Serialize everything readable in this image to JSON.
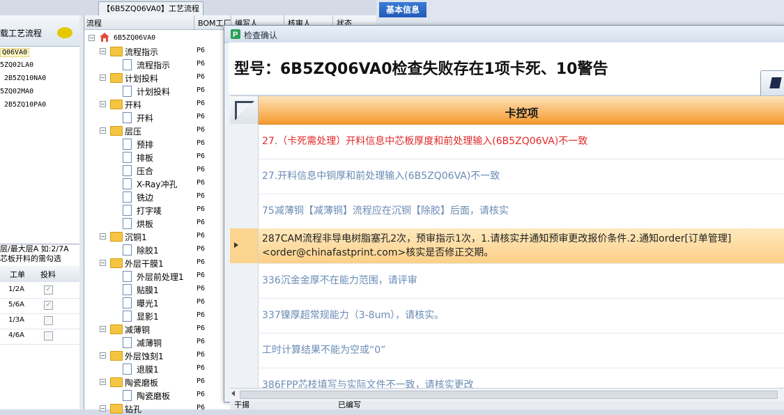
{
  "left_panel": {
    "title": "载工艺流程",
    "items": [
      "Q06VA0",
      "5ZQ02LA0",
      "2B5ZQ10NA0",
      "5ZQ02MA0",
      "2B5ZQ10PA0"
    ],
    "hint_line1": "层/最大层A 如:2/7A",
    "hint_line2": "芯板开料的需勾选",
    "table_headers": {
      "order": "工单",
      "feed": "投料"
    },
    "table_rows": [
      {
        "order": "1/2A",
        "checked": true
      },
      {
        "order": "5/6A",
        "checked": true
      },
      {
        "order": "1/3A",
        "checked": false
      },
      {
        "order": "4/6A",
        "checked": false
      }
    ]
  },
  "middle": {
    "title": "【6B5ZQ06VA0】工艺流程",
    "headers": {
      "flow": "流程",
      "bom": "BOM工厂",
      "writer": "编写人",
      "reviewer": "核审人",
      "status": "状态"
    },
    "root": "6B5ZQ06VA0",
    "tree": [
      {
        "label": "流程指示",
        "level": 1,
        "bom": "P6"
      },
      {
        "label": "流程指示",
        "level": 2,
        "bom": "P6"
      },
      {
        "label": "计划投料",
        "level": 1,
        "bom": "P6"
      },
      {
        "label": "计划投料",
        "level": 2,
        "bom": "P6"
      },
      {
        "label": "开料",
        "level": 1,
        "bom": "P6"
      },
      {
        "label": "开料",
        "level": 2,
        "bom": "P6"
      },
      {
        "label": "层压",
        "level": 1,
        "bom": "P6"
      },
      {
        "label": "预排",
        "level": 2,
        "bom": "P6"
      },
      {
        "label": "排板",
        "level": 2,
        "bom": "P6"
      },
      {
        "label": "压合",
        "level": 2,
        "bom": "P6"
      },
      {
        "label": "X-Ray冲孔",
        "level": 2,
        "bom": "P6"
      },
      {
        "label": "铣边",
        "level": 2,
        "bom": "P6"
      },
      {
        "label": "打字唛",
        "level": 2,
        "bom": "P6"
      },
      {
        "label": "烘板",
        "level": 2,
        "bom": "P6"
      },
      {
        "label": "沉铜1",
        "level": 1,
        "bom": "P6"
      },
      {
        "label": "除胶1",
        "level": 2,
        "bom": "P6"
      },
      {
        "label": "外层干膜1",
        "level": 1,
        "bom": "P6"
      },
      {
        "label": "外层前处理1",
        "level": 2,
        "bom": "P6"
      },
      {
        "label": "贴膜1",
        "level": 2,
        "bom": "P6"
      },
      {
        "label": "曝光1",
        "level": 2,
        "bom": "P6"
      },
      {
        "label": "显影1",
        "level": 2,
        "bom": "P6"
      },
      {
        "label": "减薄铜",
        "level": 1,
        "bom": "P6"
      },
      {
        "label": "减薄铜",
        "level": 2,
        "bom": "P6"
      },
      {
        "label": "外层蚀刻1",
        "level": 1,
        "bom": "P6"
      },
      {
        "label": "退膜1",
        "level": 2,
        "bom": "P6"
      },
      {
        "label": "陶瓷磨板",
        "level": 1,
        "bom": "P6"
      },
      {
        "label": "陶瓷磨板",
        "level": 2,
        "bom": "P6"
      },
      {
        "label": "钻孔",
        "level": 1,
        "bom": "P6"
      }
    ]
  },
  "right": {
    "tab_label": "基本信息"
  },
  "dialog": {
    "title": "检查确认",
    "heading": "型号：6B5ZQ06VA0检查失败存在1项卡死、10警告",
    "column_header": "卡控项",
    "rows": [
      {
        "text": "27.（卡死需处理）开料信息中芯板厚度和前处理输入(6B5ZQ06VA)不一致",
        "type": "error"
      },
      {
        "text": "27.开料信息中铜厚和前处理输入(6B5ZQ06VA)不一致",
        "type": "warn"
      },
      {
        "text": "75减薄铜【减薄铜】流程应在沉铜【除胶】后面，请核实",
        "type": "warn"
      },
      {
        "text": "287CAM流程非导电树脂塞孔2次，预审指示1次，1.请核实并通知预审更改报价条件.2.通知order[订单管理]<order@chinafastprint.com>核实是否修正交期。",
        "type": "selected"
      },
      {
        "text": "336沉金金厚不在能力范围，请评审",
        "type": "warn"
      },
      {
        "text": "337镍厚超常规能力（3-8um），请核实。",
        "type": "warn"
      },
      {
        "text": "工时计算结果不能为空或“0”",
        "type": "warn"
      },
      {
        "text": "386FPP芯枝填写与实际文件不一致，请核实更改",
        "type": "warn"
      }
    ]
  },
  "bottom": {
    "left_text": "干揚",
    "right_text": "已编写"
  },
  "colors": {
    "accent_orange": "#f59a2e",
    "error_red": "#e12a2a",
    "tab_blue": "#1f5bb8"
  }
}
